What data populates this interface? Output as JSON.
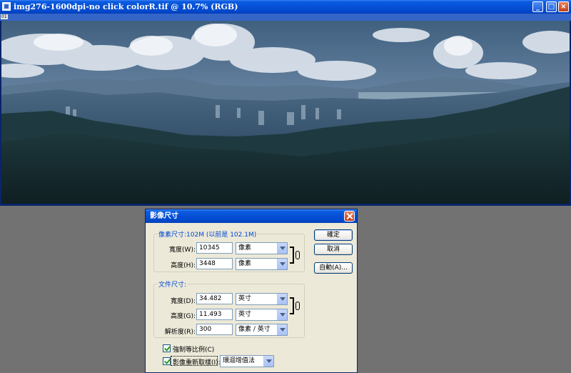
{
  "document": {
    "title": "img276-1600dpi-no click colorR.tif @ 10.7% (RGB)",
    "ruler_icons": "01",
    "window_buttons": [
      "minimize",
      "maximize",
      "close"
    ]
  },
  "dialog": {
    "title": "影像尺寸",
    "pixel_dimensions": {
      "legend": "像素尺寸:102M (以前是 102.1M)",
      "width_label": "寬度(W):",
      "width_value": "10345",
      "width_unit": "像素",
      "height_label": "高度(H):",
      "height_value": "3448",
      "height_unit": "像素"
    },
    "document_size": {
      "legend": "文件尺寸:",
      "width_label": "寬度(D):",
      "width_value": "34.482",
      "width_unit": "英寸",
      "height_label": "高度(G):",
      "height_value": "11.493",
      "height_unit": "英寸",
      "resolution_label": "解析度(R):",
      "resolution_value": "300",
      "resolution_unit": "像素 / 英寸"
    },
    "buttons": {
      "ok": "確定",
      "cancel": "取消",
      "auto": "自動(A)..."
    },
    "options": {
      "constrain_label": "強制等比例(C)",
      "constrain_checked": true,
      "resample_label": "影像重新取樣(I):",
      "resample_checked": true,
      "resample_method": "環迴增值法"
    }
  },
  "colors": {
    "titlebar_blue": "#0650d6",
    "dialog_bg": "#ece9d8",
    "legend_blue": "#0046d5",
    "workspace_gray": "#727272"
  }
}
